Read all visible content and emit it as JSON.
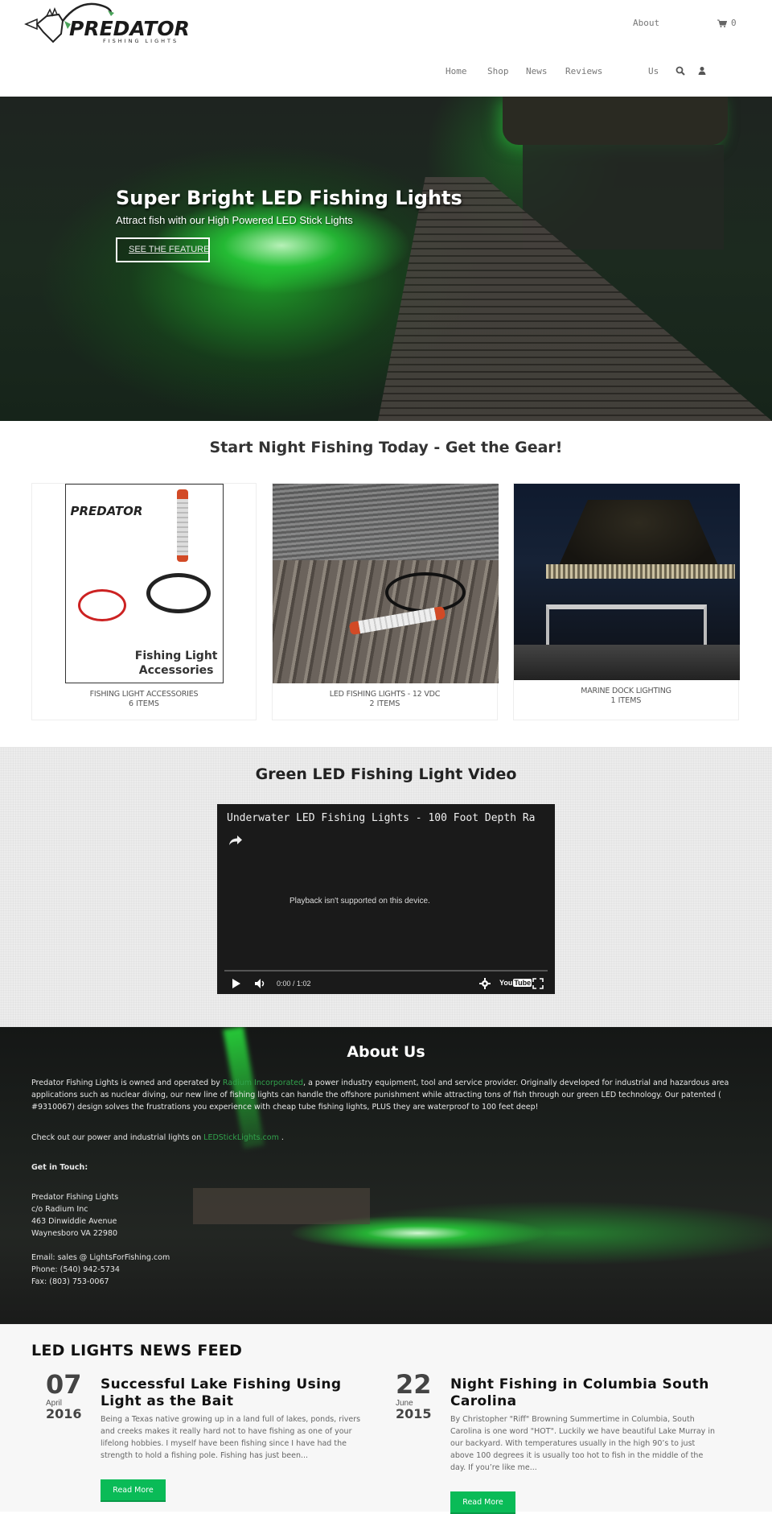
{
  "header": {
    "logo_text": "PREDATOR",
    "logo_tagline": "FISHING LIGHTS",
    "top_nav": {
      "about_label": "About",
      "cart_count": "0"
    },
    "main_nav": [
      {
        "label": "Home"
      },
      {
        "label": "Shop"
      },
      {
        "label": "News"
      },
      {
        "label": "Reviews"
      },
      {
        "label": "Us"
      }
    ],
    "icons": [
      "cart-icon",
      "search-icon",
      "user-icon"
    ]
  },
  "hero": {
    "title": "Super Bright LED Fishing Lights",
    "subtitle": "Attract fish with our High Powered LED Stick Lights",
    "button_label": "SEE THE FEATURES"
  },
  "gear": {
    "title": "Start Night Fishing Today - Get the Gear!",
    "collections": [
      {
        "title": "FISHING LIGHT ACCESSORIES",
        "count": "6 ITEMS",
        "image_caption_line1": "Fishing Light",
        "image_caption_line2": "Accessories",
        "image_logo": "PREDATOR"
      },
      {
        "title": "LED FISHING LIGHTS - 12 VDC",
        "count": "2 ITEMS"
      },
      {
        "title": "MARINE DOCK LIGHTING",
        "count": "1 ITEMS"
      }
    ]
  },
  "video": {
    "section_title": "Green LED Fishing Light Video",
    "player_title": "Underwater LED Fishing Lights - 100 Foot Depth Ra",
    "message": "Playback isn't supported on this device.",
    "time": "0:00 / 1:02",
    "youtube_label_a": "You",
    "youtube_label_b": "Tube"
  },
  "about": {
    "title": "About Us",
    "p1_before": "Predator Fishing Lights is owned and operated by ",
    "p1_link": "Radium Incorporated",
    "p1_after": ", a power industry equipment, tool and service provider. Originally developed for industrial and hazardous area applications such as nuclear diving, our new line of fishing lights can handle the offshore punishment while attracting tons of fish through our green LED technology. Our patented ( #9310067) design solves the frustrations you experience with cheap tube fishing lights, PLUS they are waterproof to 100 feet deep!",
    "p2_before": "Check out our power and industrial lights on ",
    "p2_link": "LEDStickLights.com",
    "p2_after": " .",
    "get_in_touch": "Get in Touch:",
    "address": [
      "Predator Fishing Lights",
      "c/o Radium Inc",
      "463 Dinwiddie Avenue",
      "Waynesboro VA 22980"
    ],
    "contact": [
      "Email: sales @ LightsForFishing.com",
      "Phone: (540) 942-5734",
      "Fax: (803) 753-0067"
    ],
    "link_color": "#31a24c"
  },
  "news": {
    "title": "LED LIGHTS NEWS FEED",
    "posts": [
      {
        "day": "07",
        "month": "April",
        "year": "2016",
        "title": "Successful Lake Fishing Using Light as the Bait",
        "excerpt": "Being a Texas native growing up in a land full of lakes, ponds, rivers and creeks makes it really hard not to have fishing as one of your lifelong hobbies. I myself have been fishing since I have had the strength to hold a fishing pole. Fishing has just been...",
        "button_label": "Read More"
      },
      {
        "day": "22",
        "month": "June",
        "year": "2015",
        "title": "Night Fishing in Columbia South Carolina",
        "excerpt": "By Christopher \"Riff\" Browning Summertime in Columbia, South Carolina is one word \"HOT\".  Luckily we have beautiful Lake Murray in our backyard.  With temperatures usually in the high 90’s to just above 100 degrees it is usually too hot to fish in the middle of the day.  If you’re like me...",
        "button_label": "Read More"
      }
    ],
    "button_color": "#0abb57"
  }
}
